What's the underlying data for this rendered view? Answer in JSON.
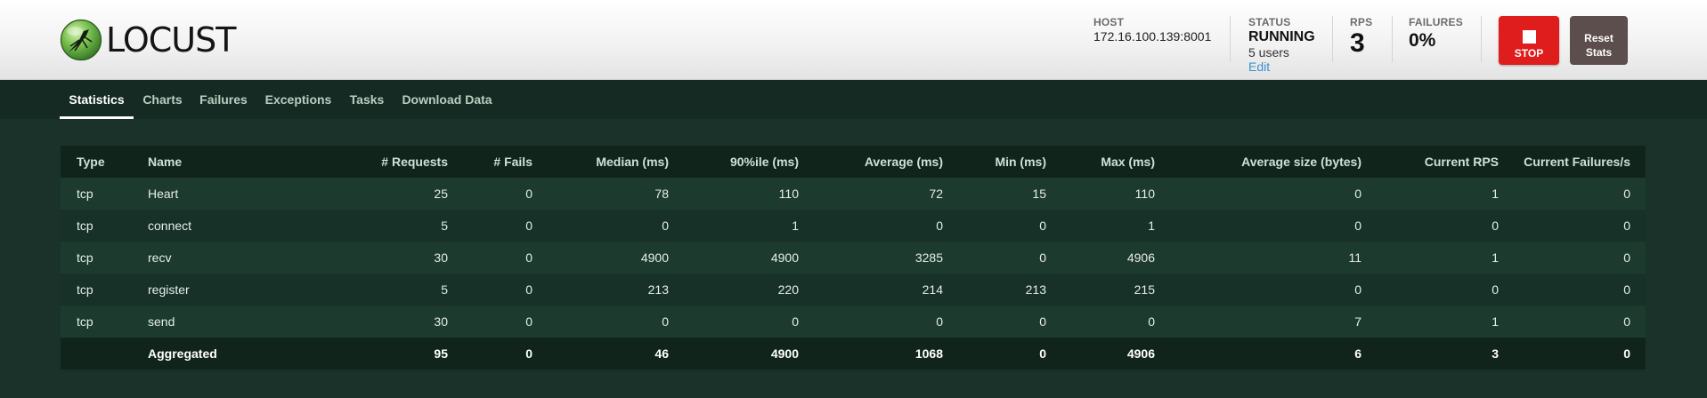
{
  "app": {
    "logo_text": "LOCUST"
  },
  "header": {
    "host": {
      "label": "HOST",
      "value": "172.16.100.139:8001"
    },
    "status": {
      "label": "STATUS",
      "value": "RUNNING",
      "users": "5 users",
      "edit_label": "Edit"
    },
    "rps": {
      "label": "RPS",
      "value": "3"
    },
    "failures": {
      "label": "FAILURES",
      "value": "0%"
    },
    "stop_label": "STOP",
    "reset_label_line1": "Reset",
    "reset_label_line2": "Stats"
  },
  "nav": {
    "active": "Statistics",
    "tabs": [
      "Statistics",
      "Charts",
      "Failures",
      "Exceptions",
      "Tasks",
      "Download Data"
    ]
  },
  "stats_table": {
    "columns": [
      "Type",
      "Name",
      "# Requests",
      "# Fails",
      "Median (ms)",
      "90%ile (ms)",
      "Average (ms)",
      "Min (ms)",
      "Max (ms)",
      "Average size (bytes)",
      "Current RPS",
      "Current Failures/s"
    ],
    "rows": [
      [
        "tcp",
        "Heart",
        "25",
        "0",
        "78",
        "110",
        "72",
        "15",
        "110",
        "0",
        "1",
        "0"
      ],
      [
        "tcp",
        "connect",
        "5",
        "0",
        "0",
        "1",
        "0",
        "0",
        "1",
        "0",
        "0",
        "0"
      ],
      [
        "tcp",
        "recv",
        "30",
        "0",
        "4900",
        "4900",
        "3285",
        "0",
        "4906",
        "11",
        "1",
        "0"
      ],
      [
        "tcp",
        "register",
        "5",
        "0",
        "213",
        "220",
        "214",
        "213",
        "215",
        "0",
        "0",
        "0"
      ],
      [
        "tcp",
        "send",
        "30",
        "0",
        "0",
        "0",
        "0",
        "0",
        "0",
        "7",
        "1",
        "0"
      ]
    ],
    "aggregated": [
      "",
      "Aggregated",
      "95",
      "0",
      "46",
      "4900",
      "1068",
      "0",
      "4906",
      "6",
      "3",
      "0"
    ]
  },
  "colors": {
    "header_bg": "#f1f1f1",
    "nav_bg": "#152a22",
    "page_bg": "#1a3229",
    "stop_button": "#e01d1d",
    "reset_button": "#5c4e4c",
    "edit_link": "#3a8fd0"
  },
  "icons": {
    "logo": "locust-logo-icon",
    "stop": "stop-square-icon"
  }
}
